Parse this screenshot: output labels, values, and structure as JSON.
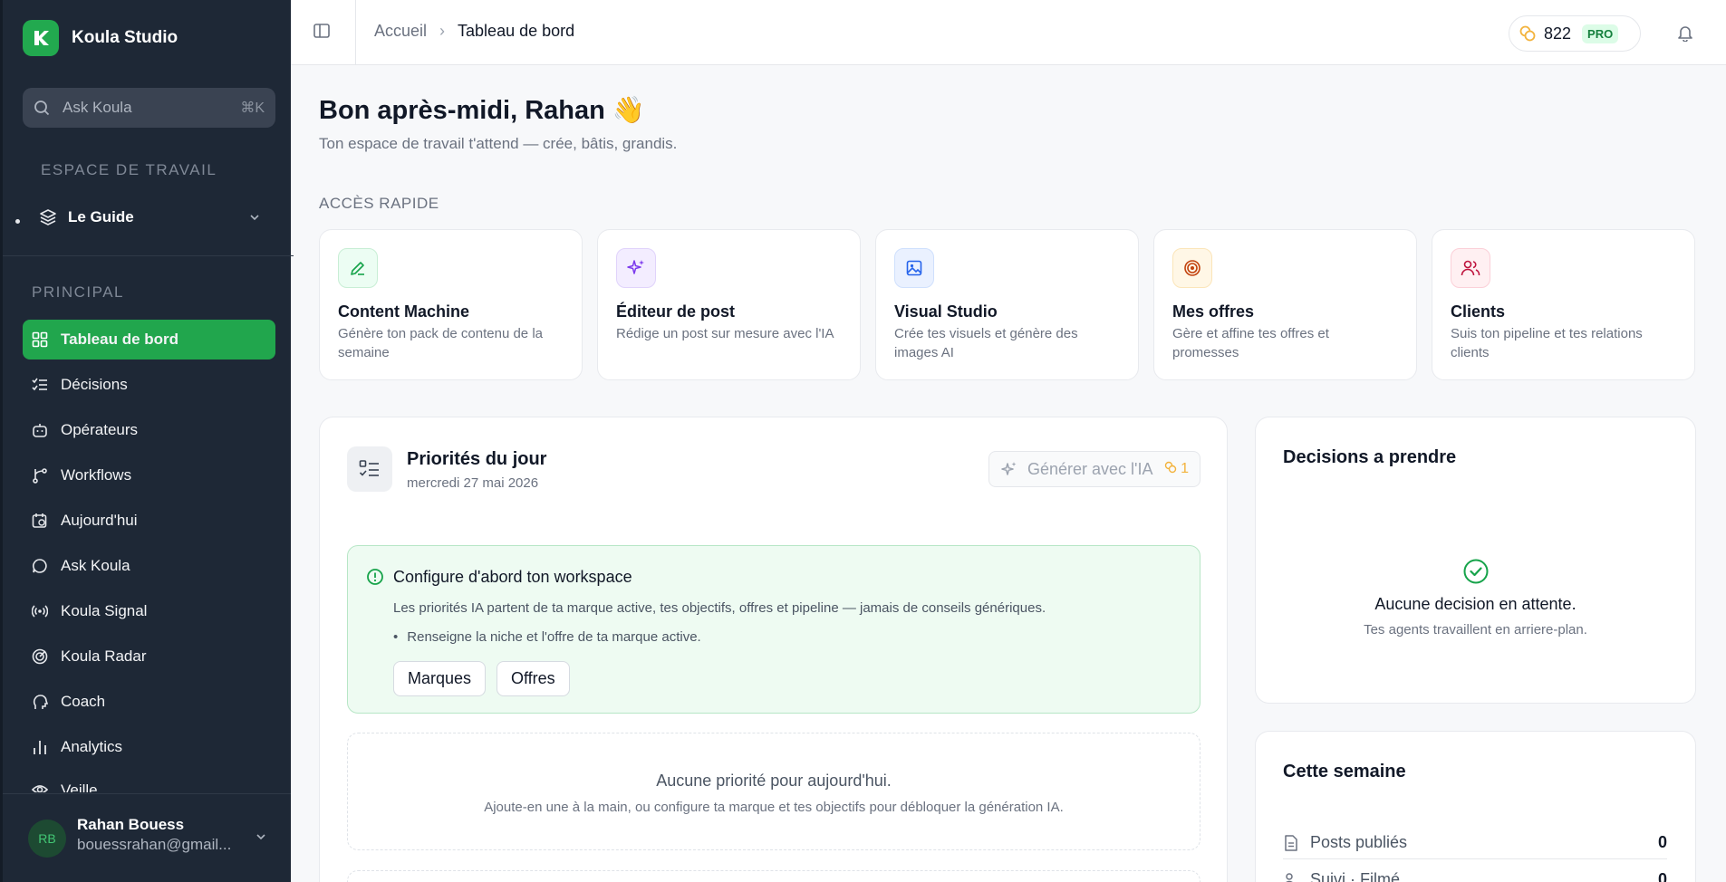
{
  "sidebar": {
    "brand": "Koula Studio",
    "search_placeholder": "Ask Koula",
    "search_shortcut": "⌘K",
    "workspace_label": "ESPACE DE TRAVAIL",
    "workspace_item": "Le Guide",
    "main_label": "PRINCIPAL",
    "items": [
      {
        "label": "Tableau de bord",
        "icon": "dashboard-icon"
      },
      {
        "label": "Décisions",
        "icon": "checklist-icon"
      },
      {
        "label": "Opérateurs",
        "icon": "bot-icon"
      },
      {
        "label": "Workflows",
        "icon": "branch-icon"
      },
      {
        "label": "Aujourd'hui",
        "icon": "calendar-clock-icon"
      },
      {
        "label": "Ask Koula",
        "icon": "chat-icon"
      },
      {
        "label": "Koula Signal",
        "icon": "signal-icon"
      },
      {
        "label": "Koula Radar",
        "icon": "radar-icon"
      },
      {
        "label": "Coach",
        "icon": "coach-icon"
      },
      {
        "label": "Analytics",
        "icon": "bar-chart-icon"
      },
      {
        "label": "Veille",
        "icon": "eye-icon"
      }
    ],
    "user": {
      "initials": "RB",
      "name": "Rahan Bouess",
      "email": "bouessrahan@gmail..."
    }
  },
  "topbar": {
    "breadcrumb_home": "Accueil",
    "breadcrumb_sep": "›",
    "breadcrumb_current": "Tableau de bord",
    "credits": "822",
    "plan": "PRO"
  },
  "main": {
    "greeting": "Bon après-midi, Rahan 👋",
    "subtitle": "Ton espace de travail t'attend — crée, bâtis, grandis.",
    "quick_access_label": "ACCÈS RAPIDE",
    "quick_access": [
      {
        "title": "Content Machine",
        "desc": "Génère ton pack de contenu de la semaine",
        "icon": "pencil-icon",
        "color": "#16a34a",
        "bg": "#ecfdf3"
      },
      {
        "title": "Éditeur de post",
        "desc": "Rédige un post sur mesure avec l'IA",
        "icon": "sparkles-icon",
        "color": "#7c3aed",
        "bg": "#f3edff"
      },
      {
        "title": "Visual Studio",
        "desc": "Crée tes visuels et génère des images AI",
        "icon": "image-icon",
        "color": "#2563eb",
        "bg": "#eaf1ff"
      },
      {
        "title": "Mes offres",
        "desc": "Gère et affine tes offres et promesses",
        "icon": "target-icon",
        "color": "#c2410c",
        "bg": "#fff7e6"
      },
      {
        "title": "Clients",
        "desc": "Suis ton pipeline et tes relations clients",
        "icon": "users-icon",
        "color": "#be123c",
        "bg": "#fff0f2"
      }
    ],
    "priorities": {
      "title": "Priorités du jour",
      "date": "mercredi 27 mai 2026",
      "generate_label": "Générer avec l'IA",
      "generate_cost": "1",
      "alert_title": "Configure d'abord ton workspace",
      "alert_text": "Les priorités IA partent de ta marque active, tes objectifs, offres et pipeline — jamais de conseils génériques.",
      "alert_bullet": "Renseigne la niche et l'offre de ta marque active.",
      "btn_brands": "Marques",
      "btn_offers": "Offres",
      "empty_title": "Aucune priorité pour aujourd'hui.",
      "empty_sub": "Ajoute-en une à la main, ou configure ta marque et tes objectifs pour débloquer la génération IA."
    },
    "decisions": {
      "title": "Decisions a prendre",
      "empty": "Aucune decision en attente.",
      "sub": "Tes agents travaillent en arriere-plan."
    },
    "week": {
      "title": "Cette semaine",
      "stats": [
        {
          "label": "Posts publiés",
          "value": "0"
        },
        {
          "label": "Suivi · Filmé",
          "value": "0"
        }
      ]
    }
  },
  "colors": {
    "sidebar_bg": "#1e2836",
    "accent": "#21a64d"
  }
}
